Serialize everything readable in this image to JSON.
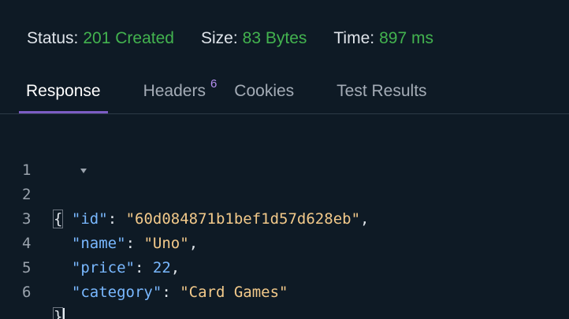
{
  "status": {
    "status_label": "Status:",
    "status_value": "201 Created",
    "size_label": "Size:",
    "size_value": "83 Bytes",
    "time_label": "Time:",
    "time_value": "897 ms"
  },
  "tabs": [
    {
      "label": "Response",
      "active": true
    },
    {
      "label": "Headers",
      "badge": "6"
    },
    {
      "label": "Cookies"
    },
    {
      "label": "Test Results"
    }
  ],
  "editor": {
    "lines": [
      {
        "n": "1",
        "open": "{"
      },
      {
        "n": "2",
        "key": "id",
        "value": "60d084871b1bef1d57d628eb",
        "kind": "string"
      },
      {
        "n": "3",
        "key": "name",
        "value": "Uno",
        "kind": "string"
      },
      {
        "n": "4",
        "key": "price",
        "value": "22",
        "kind": "number"
      },
      {
        "n": "5",
        "key": "category",
        "value": "Card Games",
        "kind": "string"
      },
      {
        "n": "6",
        "close": "}"
      }
    ]
  },
  "colors": {
    "background": "#0e1a25",
    "status_value": "#43b34f",
    "tab_active_underline": "#7b5cc4",
    "badge": "#b48ef0",
    "json_key": "#79b8ff",
    "json_string": "#f2c98a",
    "json_number": "#79b8ff"
  },
  "icons": {
    "fold": "caret-down-icon"
  }
}
